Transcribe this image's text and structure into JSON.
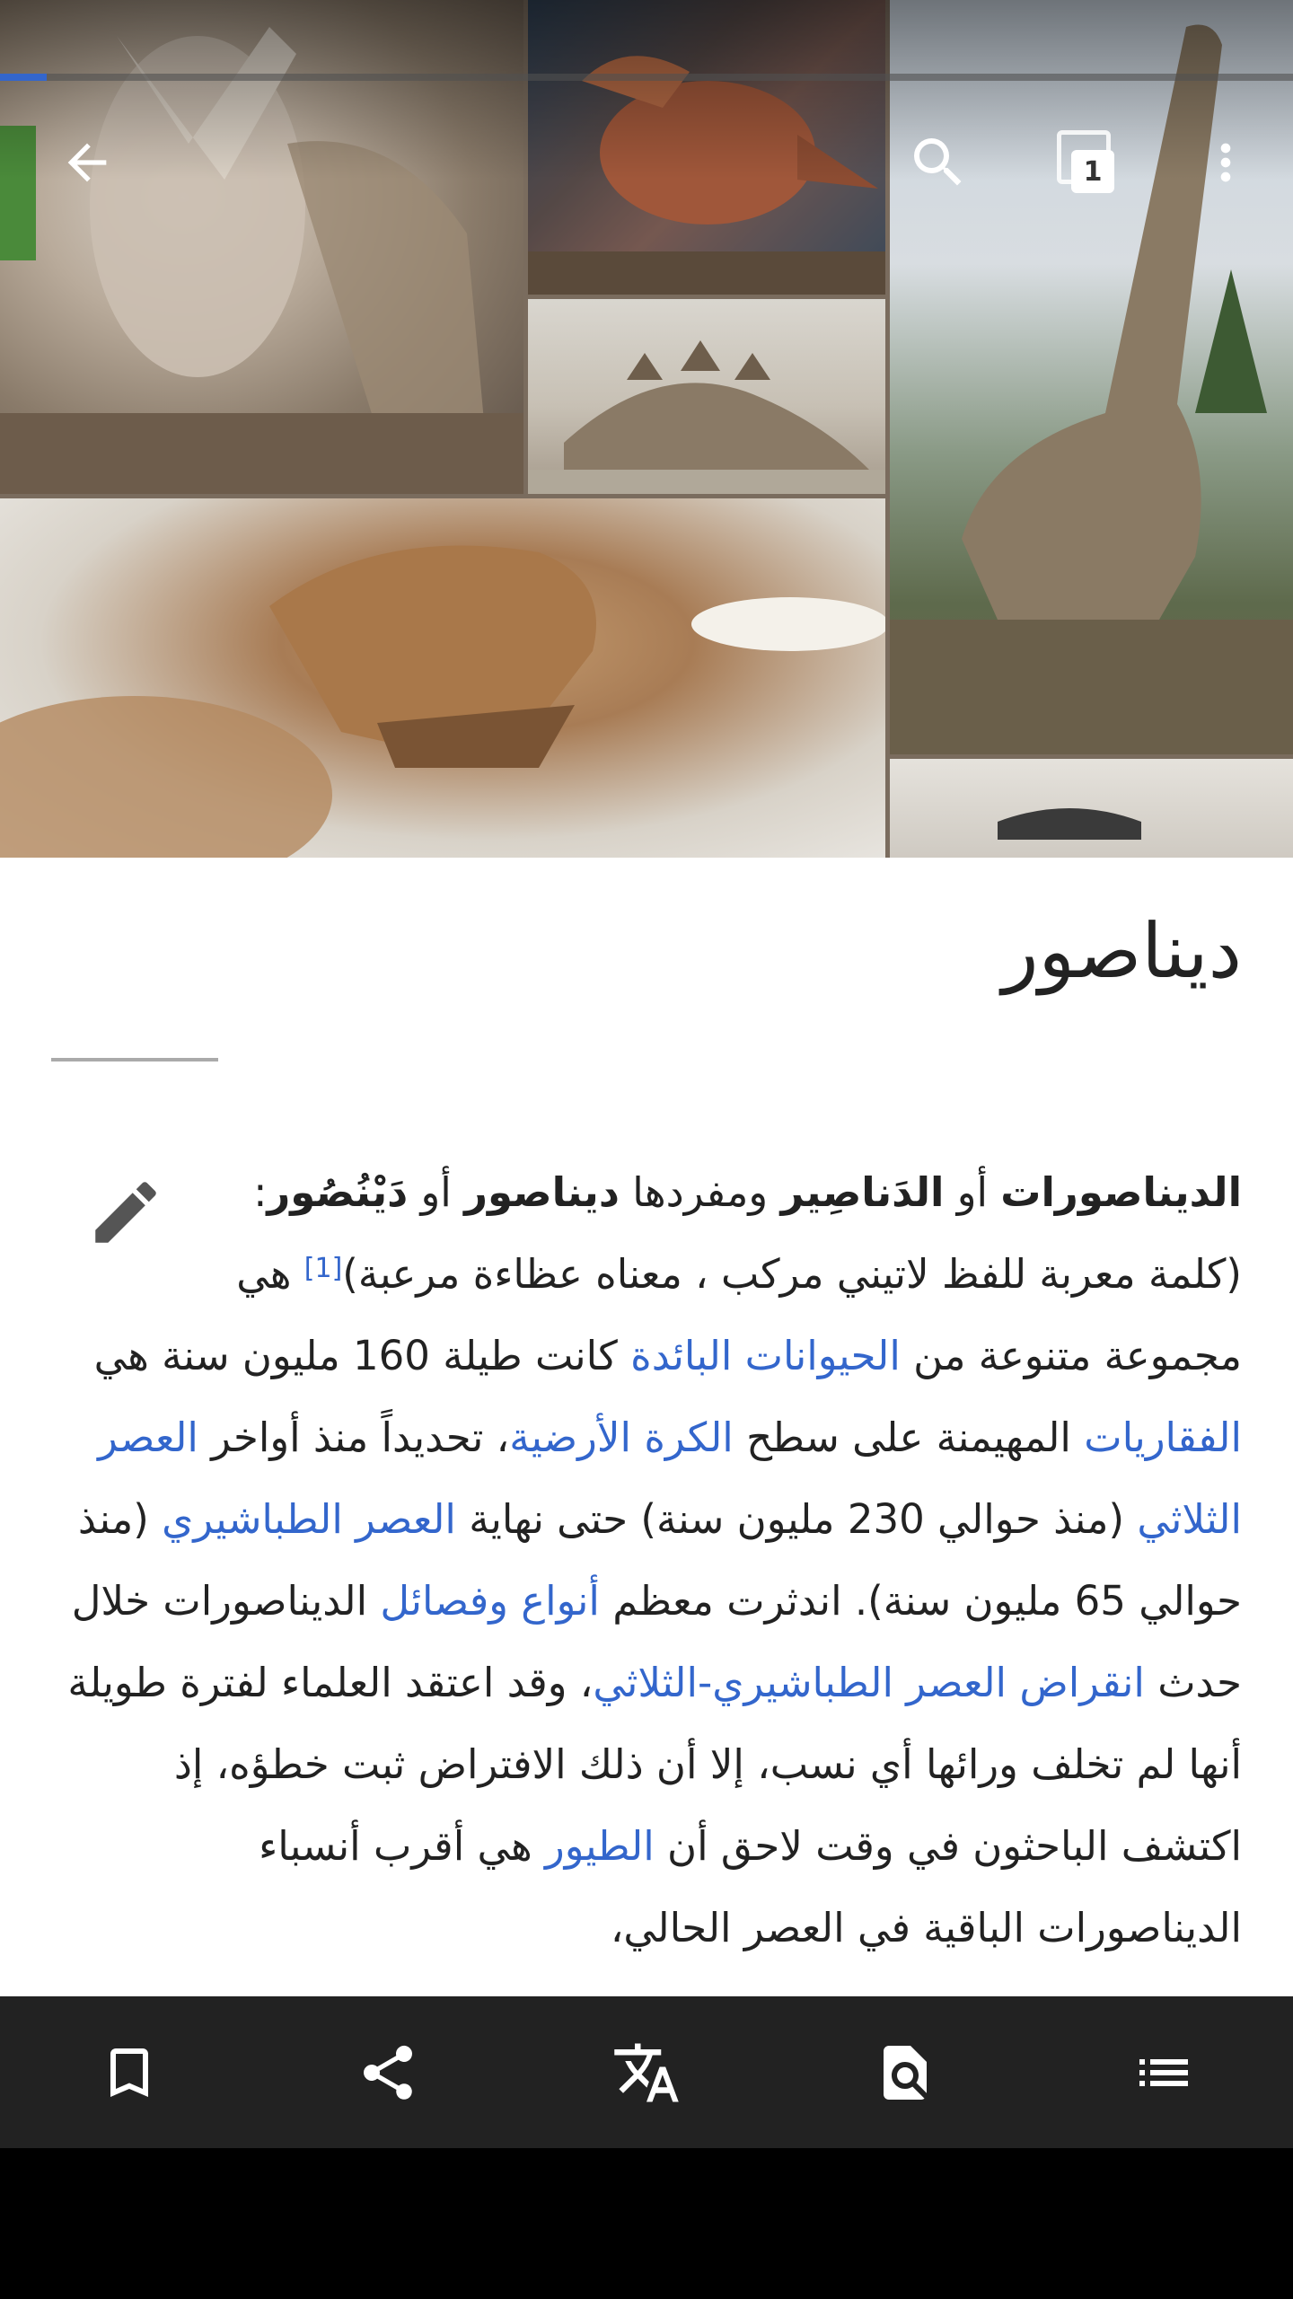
{
  "header": {
    "progress_fraction": 0.036,
    "tabs_count": "1"
  },
  "article": {
    "title": "ديناصور",
    "paragraph": [
      {
        "t": "b",
        "v": "الديناصورات"
      },
      {
        "t": "s",
        "v": " أو "
      },
      {
        "t": "b",
        "v": "الدَناصِير"
      },
      {
        "t": "s",
        "v": " ومفردها "
      },
      {
        "t": "b",
        "v": "ديناصور"
      },
      {
        "t": "s",
        "v": " أو "
      },
      {
        "t": "b",
        "v": "دَيْنُصُور"
      },
      {
        "t": "s",
        "v": ": (كلمة معربة للفظ لاتيني مركب ، معناه عظاءة مرعبة)"
      },
      {
        "t": "sup",
        "v": "[1]"
      },
      {
        "t": "s",
        "v": " هي مجموعة متنوعة من "
      },
      {
        "t": "a",
        "v": "الحيوانات البائدة"
      },
      {
        "t": "s",
        "v": " كانت طيلة 160 مليون سنة هي "
      },
      {
        "t": "a",
        "v": "الفقاريات"
      },
      {
        "t": "s",
        "v": " المهيمنة على سطح "
      },
      {
        "t": "a",
        "v": "الكرة الأرضية"
      },
      {
        "t": "s",
        "v": "، تحديداً منذ أواخر "
      },
      {
        "t": "a",
        "v": "العصر الثلاثي"
      },
      {
        "t": "s",
        "v": " (منذ حوالي 230 مليون سنة) حتى نهاية "
      },
      {
        "t": "a",
        "v": "العصر الطباشيري"
      },
      {
        "t": "s",
        "v": " (منذ حوالي 65 مليون سنة). اندثرت معظم "
      },
      {
        "t": "a",
        "v": "أنواع وفصائل"
      },
      {
        "t": "s",
        "v": " الديناصورات خلال حدث "
      },
      {
        "t": "a",
        "v": "انقراض العصر الطباشيري-الثلاثي"
      },
      {
        "t": "s",
        "v": "، وقد اعتقد العلماء لفترة طويلة أنها لم تخلف ورائها أي نسب، إلا أن ذلك الافتراض ثبت خطؤه، إذ اكتشف الباحثون في وقت لاحق أن "
      },
      {
        "t": "a",
        "v": "الطيور"
      },
      {
        "t": "s",
        "v": " هي أقرب أنسباء الديناصورات الباقية في العصر الحالي،"
      }
    ]
  },
  "bottom_bar": {
    "items": [
      {
        "name": "bookmark-button",
        "icon": "bookmark-icon"
      },
      {
        "name": "share-button",
        "icon": "share-icon"
      },
      {
        "name": "translate-button",
        "icon": "translate-icon"
      },
      {
        "name": "find-in-page-button",
        "icon": "find-in-page-icon"
      },
      {
        "name": "contents-button",
        "icon": "contents-list-icon"
      }
    ]
  },
  "colors": {
    "link": "#3366cc",
    "bottom_bar": "#222222",
    "progress": "#3366cc"
  }
}
